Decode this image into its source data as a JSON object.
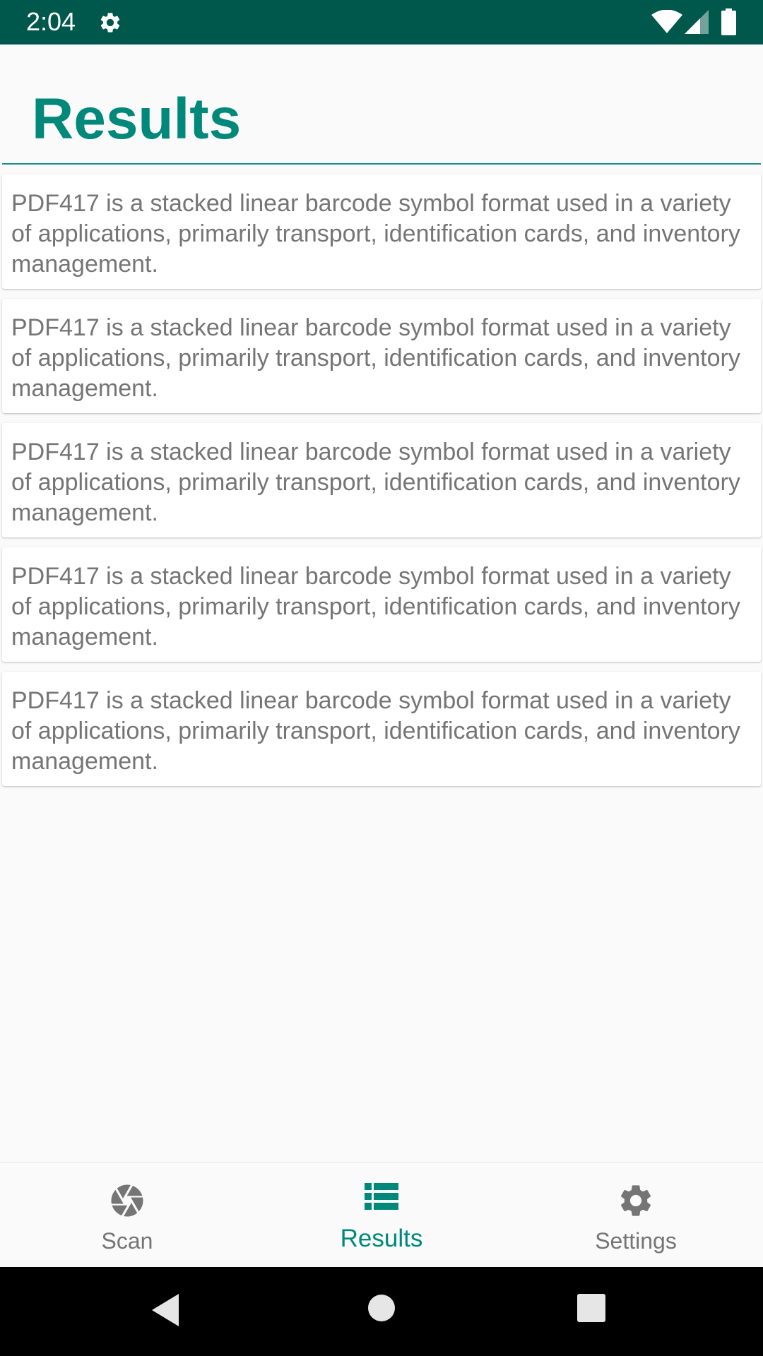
{
  "status_bar": {
    "time": "2:04",
    "background": "#00574b",
    "icons": [
      "gear-icon",
      "wifi-icon",
      "signal-icon",
      "battery-icon"
    ]
  },
  "page": {
    "title": "Results",
    "accent_color": "#00897b"
  },
  "results": [
    {
      "text": "PDF417 is a stacked linear barcode symbol format used in a variety of applications, primarily transport, identification cards, and inventory management."
    },
    {
      "text": "PDF417 is a stacked linear barcode symbol format used in a variety of applications, primarily transport, identification cards, and inventory management."
    },
    {
      "text": "PDF417 is a stacked linear barcode symbol format used in a variety of applications, primarily transport, identification cards, and inventory management."
    },
    {
      "text": "PDF417 is a stacked linear barcode symbol format used in a variety of applications, primarily transport, identification cards, and inventory management."
    },
    {
      "text": "PDF417 is a stacked linear barcode symbol format used in a variety of applications, primarily transport, identification cards, and inventory management."
    }
  ],
  "bottom_nav": {
    "items": [
      {
        "label": "Scan",
        "icon": "camera-shutter-icon",
        "active": false
      },
      {
        "label": "Results",
        "icon": "list-icon",
        "active": true
      },
      {
        "label": "Settings",
        "icon": "gear-icon",
        "active": false
      }
    ]
  },
  "system_nav": {
    "icons": [
      "back-icon",
      "home-icon",
      "recents-icon"
    ]
  }
}
